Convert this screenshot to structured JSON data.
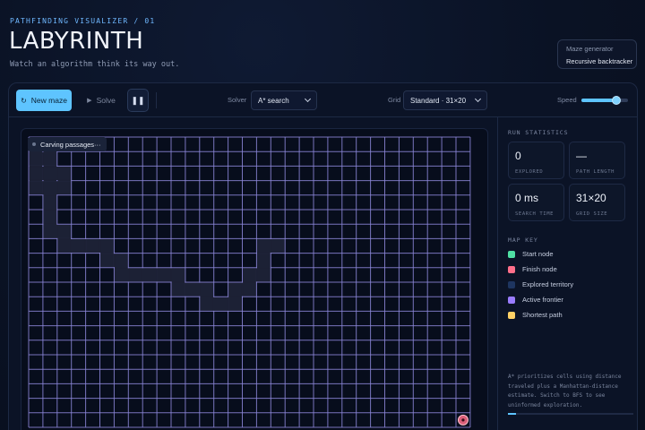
{
  "header": {
    "eyebrow": "PATHFINDING VISUALIZER / 01",
    "title": "LABYRINTH",
    "tagline": "Watch an algorithm think its way out."
  },
  "generator": {
    "label": "Maze generator",
    "value": "Recursive backtracker"
  },
  "toolbar": {
    "new_maze_label": "New maze",
    "new_maze_icon": "refresh-icon",
    "solve_label": "Solve",
    "solve_icon": "play-icon",
    "pause_icon": "pause-icon",
    "solver_label": "Solver",
    "solver_value": "A* search",
    "grid_label": "Grid",
    "grid_value": "Standard · 31×20",
    "speed_label": "Speed",
    "speed_level": 0.75
  },
  "maze": {
    "status": "Carving passages···",
    "cols": 31,
    "rows": 20,
    "finish_cell": [
      30,
      19
    ],
    "carved_cells": [
      [
        0,
        0
      ],
      [
        1,
        0
      ],
      [
        0,
        1
      ],
      [
        1,
        1
      ],
      [
        0,
        2
      ],
      [
        1,
        2
      ],
      [
        2,
        2
      ],
      [
        0,
        3
      ],
      [
        1,
        3
      ],
      [
        2,
        3
      ],
      [
        1,
        4
      ],
      [
        1,
        5
      ],
      [
        1,
        6
      ],
      [
        2,
        6
      ],
      [
        2,
        7
      ],
      [
        3,
        7
      ],
      [
        4,
        7
      ],
      [
        5,
        7
      ],
      [
        5,
        8
      ],
      [
        6,
        8
      ],
      [
        6,
        9
      ],
      [
        7,
        9
      ],
      [
        8,
        9
      ],
      [
        9,
        9
      ],
      [
        10,
        9
      ],
      [
        10,
        10
      ],
      [
        11,
        10
      ],
      [
        12,
        10
      ],
      [
        12,
        11
      ],
      [
        13,
        11
      ],
      [
        14,
        11
      ],
      [
        14,
        10
      ],
      [
        15,
        10
      ],
      [
        15,
        9
      ],
      [
        16,
        9
      ],
      [
        16,
        8
      ],
      [
        16,
        7
      ],
      [
        17,
        7
      ]
    ]
  },
  "stats": {
    "section_label": "RUN STATISTICS",
    "items": [
      {
        "value": "0",
        "label": "EXPLORED"
      },
      {
        "value": "—",
        "label": "PATH LENGTH"
      },
      {
        "value": "0 ms",
        "label": "SEARCH TIME"
      },
      {
        "value": "31×20",
        "label": "GRID SIZE"
      }
    ]
  },
  "map_key": {
    "section_label": "MAP KEY",
    "items": [
      {
        "label": "Start node",
        "color": "#4fe0a4"
      },
      {
        "label": "Finish node",
        "color": "#ff6f8a"
      },
      {
        "label": "Explored territory",
        "color": "#1e3560"
      },
      {
        "label": "Active frontier",
        "color": "#9a7cff"
      },
      {
        "label": "Shortest path",
        "color": "#ffd166"
      }
    ]
  },
  "note": "A* prioritizes cells using distance traveled plus a Manhattan-distance estimate. Switch to BFS to see uninformed exploration.",
  "colors": {
    "accent": "#5ec4ff",
    "grid_line": "#8c87d9",
    "carved": "#1c2135",
    "finish": "#ff6f8a"
  }
}
